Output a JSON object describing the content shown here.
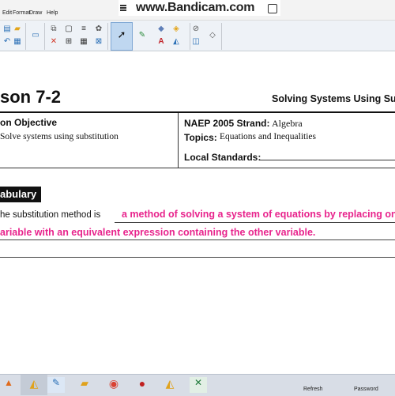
{
  "menubar": {
    "items": [
      "Edit",
      "Format",
      "Draw",
      "Help"
    ]
  },
  "watermark": {
    "text": "www.Bandicam.com"
  },
  "toolbar": {
    "icons": [
      "new-page-icon",
      "open-icon",
      "undo-icon",
      "screen-icon",
      "copy-icon",
      "delete-icon",
      "table-icon",
      "spell-icon",
      "select-icon",
      "pen-icon",
      "eraser-icon",
      "text-icon",
      "fill-icon",
      "shape-icon"
    ]
  },
  "lesson": {
    "title": "son 7-2",
    "subtitle": "Solving Systems Using Su"
  },
  "objective": {
    "heading": "on Objective",
    "text": "Solve systems using substitution"
  },
  "naep": {
    "label": "NAEP 2005 Strand:",
    "value": "Algebra"
  },
  "topics": {
    "label": "Topics:",
    "value": "Equations and Inequalities"
  },
  "local": {
    "label": "Local Standards:"
  },
  "vocab": {
    "heading": "abulary",
    "lead": "he substitution method is",
    "definition_line1": "a method of solving a system of equations by replacing one",
    "definition_line2": "ariable with an equivalent expression containing the other variable."
  },
  "colors": {
    "ink": "#e8238c",
    "vocab_bg": "#111111"
  },
  "taskbar": {
    "refresh_label": "Refresh",
    "password_label": "Password"
  }
}
